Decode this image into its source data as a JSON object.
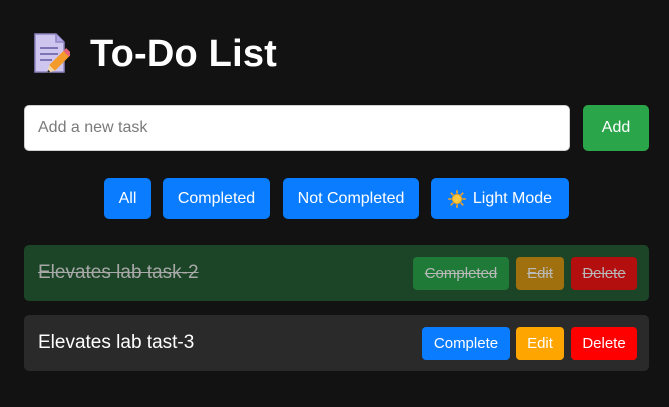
{
  "header": {
    "title": "To-Do List",
    "icon": "memo-pencil-icon"
  },
  "new_task": {
    "placeholder": "Add a new task",
    "value": "",
    "add_label": "Add"
  },
  "filters": {
    "all": "All",
    "completed": "Completed",
    "not_completed": "Not Completed",
    "theme_toggle": "Light Mode",
    "theme_icon": "sun-icon"
  },
  "tasks": [
    {
      "text": "Elevates lab task-2",
      "completed": true,
      "complete_label": "Completed",
      "edit_label": "Edit",
      "delete_label": "Delete"
    },
    {
      "text": "Elevates lab tast-3",
      "completed": false,
      "complete_label": "Complete",
      "edit_label": "Edit",
      "delete_label": "Delete"
    }
  ],
  "colors": {
    "background": "#121212",
    "primary": "#0a7cff",
    "add": "#2aa54a",
    "edit": "#ffa500",
    "delete": "#ff0000",
    "completed_row": "#1c4527",
    "open_row": "#2a2a2a"
  }
}
